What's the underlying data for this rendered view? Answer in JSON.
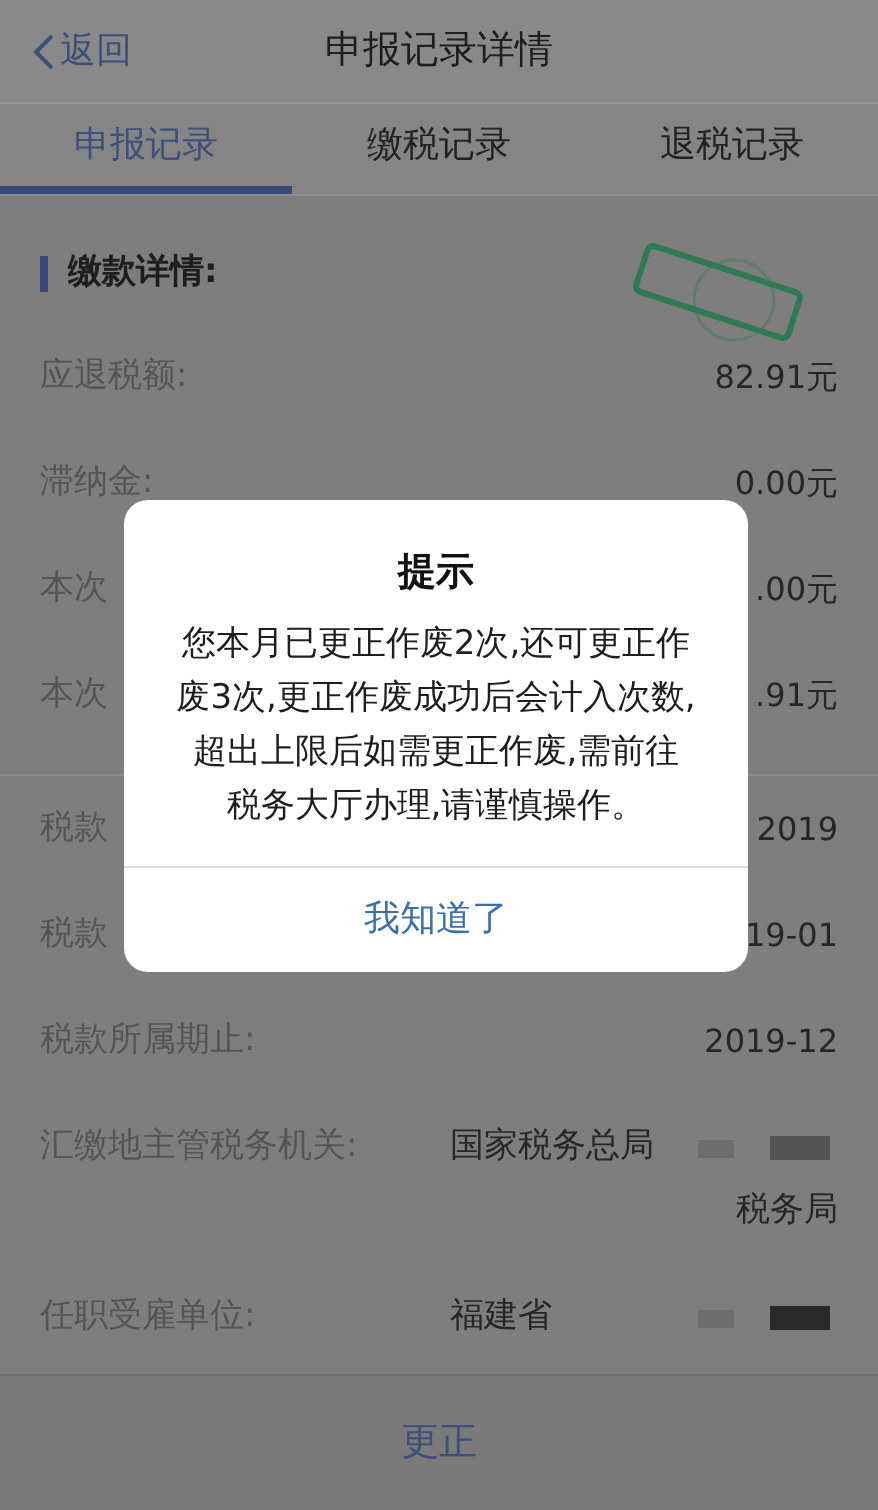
{
  "header": {
    "back": "返回",
    "title": "申报记录详情"
  },
  "tabs": [
    {
      "label": "申报记录",
      "selected": true
    },
    {
      "label": "缴税记录",
      "selected": false
    },
    {
      "label": "退税记录",
      "selected": false
    }
  ],
  "section": {
    "title": "缴款详情:"
  },
  "amount_rows": [
    {
      "label": "应退税额:",
      "value": "82.91元"
    },
    {
      "label": "滞纳金:",
      "value": "0.00元"
    },
    {
      "label": "本次",
      "value": ".00元"
    },
    {
      "label": "本次",
      "value": ".91元"
    }
  ],
  "period_rows": [
    {
      "label": "税款",
      "value": "2019"
    },
    {
      "label": "税款",
      "value": "19-01"
    },
    {
      "label": "税款所属期止:",
      "value": "2019-12"
    }
  ],
  "detail_rows": [
    {
      "label": "汇缴地主管税务机关:",
      "value_lines": [
        "国家税务总局",
        "税务局"
      ]
    },
    {
      "label": "任职受雇单位:",
      "value_lines": [
        "福建省"
      ]
    }
  ],
  "action": "更正",
  "dialog": {
    "title": "提示",
    "message": "您本月已更正作废2次,还可更正作废3次,更正作废成功后会计入次数,超出上限后如需更正作废,需前往税务大厅办理,请谨慎操作。",
    "button": "我知道了"
  }
}
